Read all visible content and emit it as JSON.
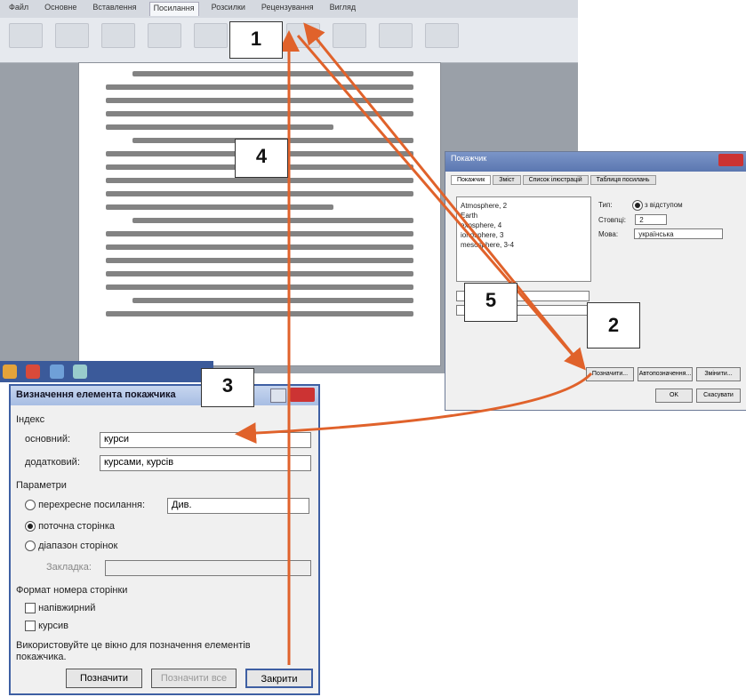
{
  "word": {
    "tabs": [
      "Файл",
      "Основне",
      "Вставлення",
      "Посилання",
      "Розсилки",
      "Рецензування",
      "Вигляд"
    ]
  },
  "index_dialog": {
    "title": "Покажчик",
    "tabs": [
      "Покажчик",
      "Зміст",
      "Список ілюстрацій",
      "Таблиця посилань"
    ],
    "preview": [
      "Atmosphere, 2",
      "Earth",
      "   exosphere, 4",
      "   ionosphere, 3",
      "   mesosphere, 3-4"
    ],
    "type_label": "Тип:",
    "type_options": [
      "з відступом",
      "із відступом"
    ],
    "columns_label": "Стовпці:",
    "columns_value": "2",
    "lang_label": "Мова:",
    "lang_value": "українська",
    "buttons": [
      "Позначити...",
      "Автопозначення...",
      "Змінити..."
    ],
    "ok": "OK",
    "cancel": "Скасувати"
  },
  "mark_dialog": {
    "title": "Визначення елемента покажчика",
    "section_index": "Індекс",
    "main_label": "основний:",
    "main_value": "курси",
    "sub_label": "додатковий:",
    "sub_value": "курсами, курсів",
    "section_params": "Параметри",
    "cross_ref_label": "перехресне посилання:",
    "cross_ref_value": "Див.",
    "current_page_label": "поточна сторінка",
    "page_range_label": "діапазон сторінок",
    "bookmark_label": "Закладка:",
    "section_format": "Формат номера сторінки",
    "bold_label": "напівжирний",
    "italic_label": "курсив",
    "hint": "Використовуйте це вікно для позначення елементів покажчика.",
    "btn_mark": "Позначити",
    "btn_mark_all": "Позначити все",
    "btn_close": "Закрити"
  },
  "callouts": [
    "1",
    "2",
    "3",
    "4",
    "5"
  ],
  "arrow_color": "#e0622b"
}
